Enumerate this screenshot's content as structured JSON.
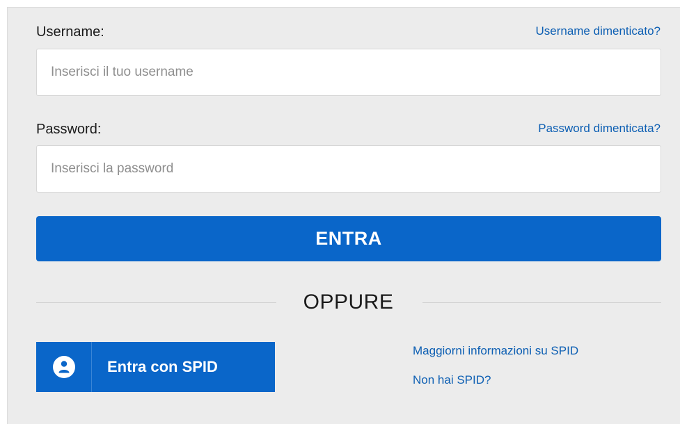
{
  "username": {
    "label": "Username:",
    "forgot_link": "Username dimenticato?",
    "placeholder": "Inserisci il tuo username",
    "value": ""
  },
  "password": {
    "label": "Password:",
    "forgot_link": "Password dimenticata?",
    "placeholder": "Inserisci la password",
    "value": ""
  },
  "login_button_label": "ENTRA",
  "divider_text": "OPPURE",
  "spid": {
    "button_label": "Entra con SPID",
    "icon": "user-icon",
    "more_info_link": "Maggiorni informazioni su SPID",
    "no_spid_link": "Non hai SPID?"
  },
  "colors": {
    "primary": "#0a66c9",
    "link": "#0d5fb3",
    "panel_background": "#ececec"
  }
}
